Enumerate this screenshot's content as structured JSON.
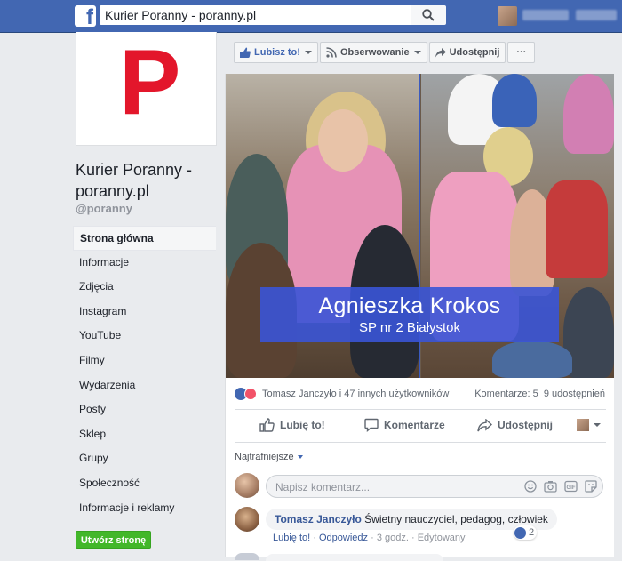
{
  "header": {
    "search_value": "Kurier Poranny - poranny.pl",
    "logo_letter": "f"
  },
  "page": {
    "logo_letter": "P",
    "name": "Kurier Poranny - poranny.pl",
    "handle": "@poranny",
    "brand_color": "#e3162b"
  },
  "sidebar": {
    "items": [
      {
        "label": "Strona główna",
        "active": true
      },
      {
        "label": "Informacje"
      },
      {
        "label": "Zdjęcia"
      },
      {
        "label": "Instagram"
      },
      {
        "label": "YouTube"
      },
      {
        "label": "Filmy"
      },
      {
        "label": "Wydarzenia"
      },
      {
        "label": "Posty"
      },
      {
        "label": "Sklep"
      },
      {
        "label": "Grupy"
      },
      {
        "label": "Społeczność"
      },
      {
        "label": "Informacje i reklamy"
      }
    ],
    "create_button": "Utwórz stronę"
  },
  "page_actions": {
    "like": "Lubisz to!",
    "follow": "Obserwowanie",
    "share": "Udostępnij",
    "more": "···"
  },
  "post": {
    "caption_name": "Agnieszka Krokos",
    "caption_school": "SP nr 2 Białystok",
    "reactions_text": "Tomasz Janczyło i 47 innych użytkowników",
    "comments_count": "Komentarze: 5",
    "shares_count": "9 udostępnień",
    "actions": {
      "like": "Lubię to!",
      "comment": "Komentarze",
      "share": "Udostępnij"
    },
    "sort_label": "Najtrafniejsze",
    "comment_placeholder": "Napisz komentarz...",
    "comments": [
      {
        "author": "Tomasz Janczyło",
        "text": "Świetny nauczyciel, pedagog, człowiek",
        "like": "Lubię to!",
        "reply": "Odpowiedz",
        "time": "3 godz.",
        "edited": "Edytowany",
        "reactions": "2"
      }
    ]
  },
  "colors": {
    "facebook_blue": "#4267b2",
    "caption_blue": "#3a54d6",
    "create_green": "#42b72a"
  }
}
